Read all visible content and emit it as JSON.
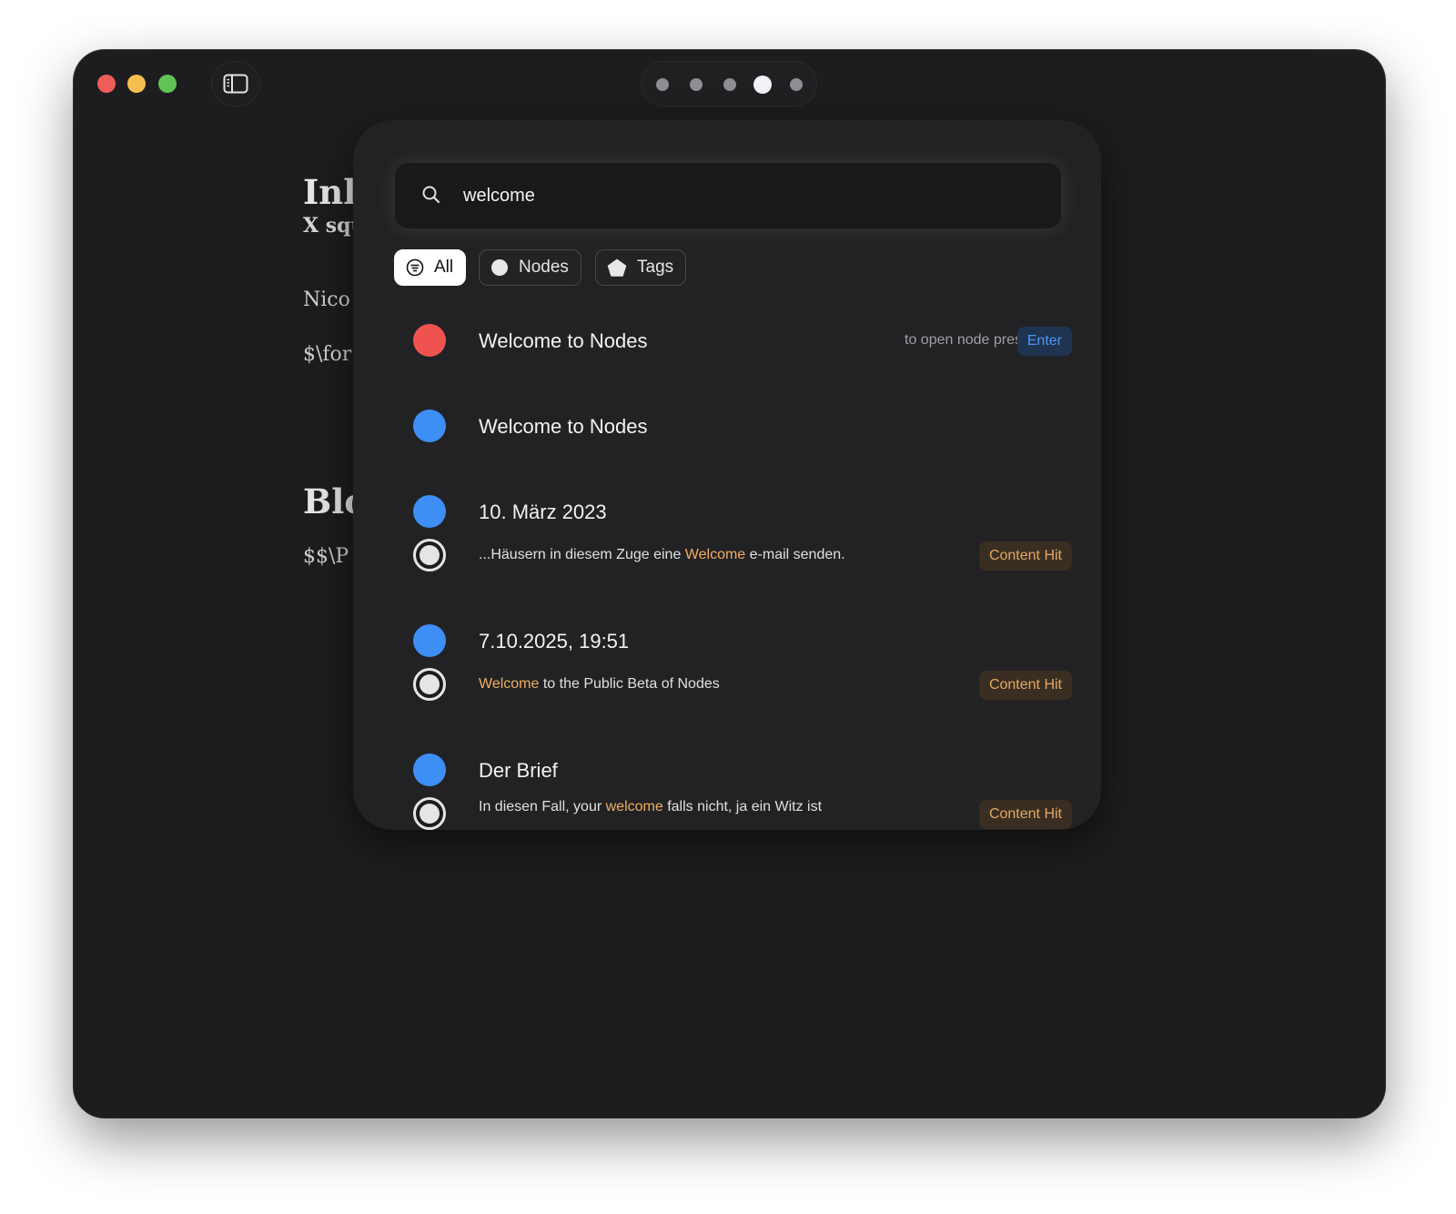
{
  "colors": {
    "window_bg": "#1d1d1f",
    "red_node": "#ee5350",
    "blue_node": "#3d8ef5",
    "highlight": "#efae60",
    "enter_text": "#4f95f5",
    "content_hit_text": "#e3a860"
  },
  "titlebar": {
    "icons": [
      "close-button",
      "minimize-button",
      "zoom-button",
      "sidebar-toggle-icon"
    ],
    "page_dots": {
      "count": 5,
      "active_index": 3
    }
  },
  "document": {
    "h1": "Inli",
    "sub": "X squ",
    "p1": "Nico",
    "p2": "$\\for",
    "h2": "Blo",
    "p3": "$$\\P"
  },
  "search": {
    "icon": "search-icon",
    "value": "welcome",
    "placeholder": ""
  },
  "filters": [
    {
      "label": "All",
      "icon": "filter-lines-icon",
      "active": true
    },
    {
      "label": "Nodes",
      "icon": "circle-icon",
      "active": false
    },
    {
      "label": "Tags",
      "icon": "pentagon-icon",
      "active": false
    }
  ],
  "results": {
    "hint": "to open node press",
    "enter_label": "Enter",
    "content_hit_label": "Content Hit",
    "items": [
      {
        "title": "Welcome to Nodes",
        "node_color": "red",
        "selected": true
      },
      {
        "title": "Welcome to Nodes",
        "node_color": "blue"
      },
      {
        "title": "10. März 2023",
        "node_color": "blue",
        "snippet": {
          "before": "...Häusern in diesem Zuge eine ",
          "match": "Welcome",
          "after": " e-mail senden."
        }
      },
      {
        "title": "7.10.2025, 19:51",
        "node_color": "blue",
        "snippet": {
          "before": "",
          "match": "Welcome",
          "after": " to the Public Beta of Nodes"
        }
      },
      {
        "title": "Der Brief",
        "node_color": "blue",
        "snippet": {
          "before": "In diesen Fall, your ",
          "match": "welcome",
          "after": " falls nicht, ja ein Witz ist"
        }
      }
    ]
  }
}
